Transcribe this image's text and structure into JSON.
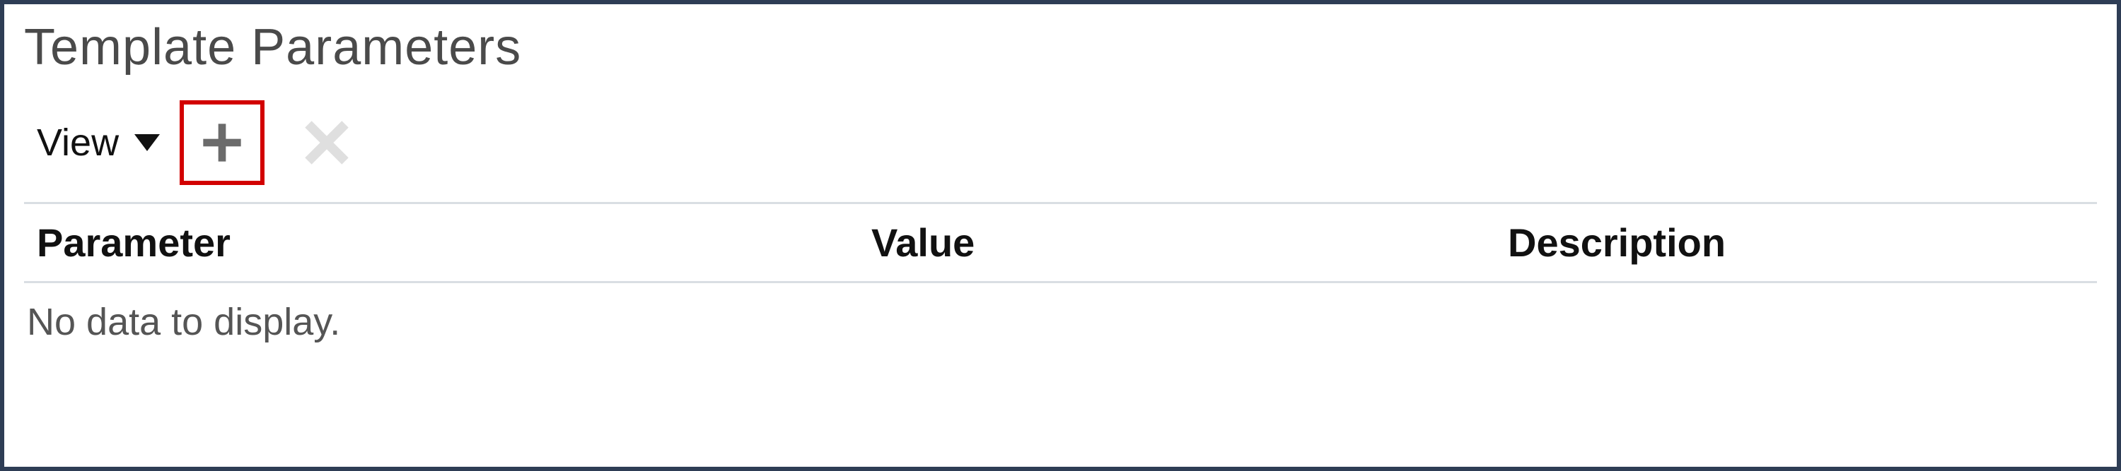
{
  "panel": {
    "title": "Template Parameters"
  },
  "toolbar": {
    "view_label": "View",
    "add_tooltip": "Add",
    "delete_tooltip": "Delete"
  },
  "table": {
    "columns": {
      "parameter": "Parameter",
      "value": "Value",
      "description": "Description"
    },
    "empty_text": "No data to display."
  }
}
